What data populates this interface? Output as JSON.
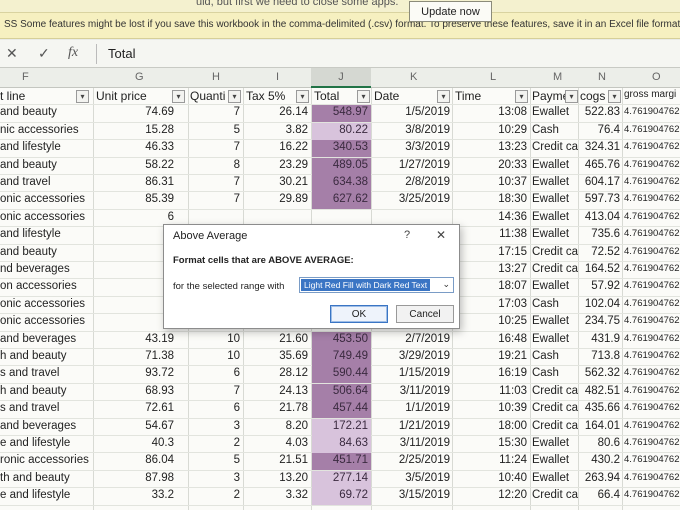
{
  "notification": {
    "update_text": "uld, but first we need to close some apps.",
    "update_button": "Update now",
    "csv_warning": "SS  Some features might be lost if you save this workbook in the comma-delimited (.csv) format. To preserve these features, save it in an Excel file format."
  },
  "formula_bar": {
    "cancel_icon": "✕",
    "enter_icon": "✓",
    "function_icon": "fx",
    "value": "Total"
  },
  "columns": [
    "F",
    "G",
    "H",
    "I",
    "J",
    "K",
    "L",
    "M",
    "N",
    "O"
  ],
  "headers": {
    "product_line": "t line",
    "unit_price": "Unit price",
    "quantity": "Quanti",
    "tax": "Tax 5%",
    "total": "Total",
    "date": "Date",
    "time": "Time",
    "payment": "Payme",
    "cogs": "cogs",
    "gross_margin": "gross margi"
  },
  "colors": {
    "total_dark": "#a57fa8",
    "total_light": "#d8c3dc",
    "dialog_accent": "#3a75c4",
    "notification_bar": "#f6f0c0"
  },
  "rows": [
    {
      "product": "and beauty",
      "price": "74.69",
      "qty": "7",
      "tax": "26.14",
      "total": "548.97",
      "date": "1/5/2019",
      "time": "13:08",
      "pay": "Ewallet",
      "cogs": "522.83",
      "gm": "4.761904762",
      "hl": "dark"
    },
    {
      "product": "nic accessories",
      "price": "15.28",
      "qty": "5",
      "tax": "3.82",
      "total": "80.22",
      "date": "3/8/2019",
      "time": "10:29",
      "pay": "Cash",
      "cogs": "76.4",
      "gm": "4.761904762",
      "hl": "light"
    },
    {
      "product": "and lifestyle",
      "price": "46.33",
      "qty": "7",
      "tax": "16.22",
      "total": "340.53",
      "date": "3/3/2019",
      "time": "13:23",
      "pay": "Credit car",
      "cogs": "324.31",
      "gm": "4.761904762",
      "hl": "dark"
    },
    {
      "product": "and beauty",
      "price": "58.22",
      "qty": "8",
      "tax": "23.29",
      "total": "489.05",
      "date": "1/27/2019",
      "time": "20:33",
      "pay": "Ewallet",
      "cogs": "465.76",
      "gm": "4.761904762",
      "hl": "dark"
    },
    {
      "product": "and travel",
      "price": "86.31",
      "qty": "7",
      "tax": "30.21",
      "total": "634.38",
      "date": "2/8/2019",
      "time": "10:37",
      "pay": "Ewallet",
      "cogs": "604.17",
      "gm": "4.761904762",
      "hl": "dark"
    },
    {
      "product": "onic accessories",
      "price": "85.39",
      "qty": "7",
      "tax": "29.89",
      "total": "627.62",
      "date": "3/25/2019",
      "time": "18:30",
      "pay": "Ewallet",
      "cogs": "597.73",
      "gm": "4.761904762",
      "hl": "dark"
    },
    {
      "product": "onic accessories",
      "price": "6",
      "qty": "",
      "tax": "",
      "total": "",
      "date": "",
      "time": "14:36",
      "pay": "Ewallet",
      "cogs": "413.04",
      "gm": "4.761904762",
      "hl": "dark"
    },
    {
      "product": "and lifestyle",
      "price": "7",
      "qty": "",
      "tax": "",
      "total": "",
      "date": "",
      "time": "11:38",
      "pay": "Ewallet",
      "cogs": "735.6",
      "gm": "4.761904762",
      "hl": "dark"
    },
    {
      "product": "and beauty",
      "price": "3",
      "qty": "",
      "tax": "",
      "total": "",
      "date": "",
      "time": "17:15",
      "pay": "Credit car",
      "cogs": "72.52",
      "gm": "4.761904762",
      "hl": "dark"
    },
    {
      "product": "nd beverages",
      "price": "5",
      "qty": "",
      "tax": "",
      "total": "",
      "date": "",
      "time": "13:27",
      "pay": "Credit car",
      "cogs": "164.52",
      "gm": "4.761904762",
      "hl": "dark"
    },
    {
      "product": "on accessories",
      "price": "1",
      "qty": "",
      "tax": "",
      "total": "",
      "date": "",
      "time": "18:07",
      "pay": "Ewallet",
      "cogs": "57.92",
      "gm": "4.761904762",
      "hl": "dark"
    },
    {
      "product": "onic accessories",
      "price": "2",
      "qty": "",
      "tax": "",
      "total": "",
      "date": "",
      "time": "17:03",
      "pay": "Cash",
      "cogs": "102.04",
      "gm": "4.761904762",
      "hl": "dark"
    },
    {
      "product": "onic accessories",
      "price": "4",
      "qty": "",
      "tax": "",
      "total": "",
      "date": "",
      "time": "10:25",
      "pay": "Ewallet",
      "cogs": "234.75",
      "gm": "4.761904762",
      "hl": "dark"
    },
    {
      "product": "and beverages",
      "price": "43.19",
      "qty": "10",
      "tax": "21.60",
      "total": "453.50",
      "date": "2/7/2019",
      "time": "16:48",
      "pay": "Ewallet",
      "cogs": "431.9",
      "gm": "4.761904762",
      "hl": "dark"
    },
    {
      "product": "h and beauty",
      "price": "71.38",
      "qty": "10",
      "tax": "35.69",
      "total": "749.49",
      "date": "3/29/2019",
      "time": "19:21",
      "pay": "Cash",
      "cogs": "713.8",
      "gm": "4.761904762",
      "hl": "dark"
    },
    {
      "product": "s and travel",
      "price": "93.72",
      "qty": "6",
      "tax": "28.12",
      "total": "590.44",
      "date": "1/15/2019",
      "time": "16:19",
      "pay": "Cash",
      "cogs": "562.32",
      "gm": "4.761904762",
      "hl": "dark"
    },
    {
      "product": "h and beauty",
      "price": "68.93",
      "qty": "7",
      "tax": "24.13",
      "total": "506.64",
      "date": "3/11/2019",
      "time": "11:03",
      "pay": "Credit car",
      "cogs": "482.51",
      "gm": "4.761904762",
      "hl": "dark"
    },
    {
      "product": "s and travel",
      "price": "72.61",
      "qty": "6",
      "tax": "21.78",
      "total": "457.44",
      "date": "1/1/2019",
      "time": "10:39",
      "pay": "Credit car",
      "cogs": "435.66",
      "gm": "4.761904762",
      "hl": "dark"
    },
    {
      "product": "and beverages",
      "price": "54.67",
      "qty": "3",
      "tax": "8.20",
      "total": "172.21",
      "date": "1/21/2019",
      "time": "18:00",
      "pay": "Credit car",
      "cogs": "164.01",
      "gm": "4.761904762",
      "hl": "light"
    },
    {
      "product": "e and lifestyle",
      "price": "40.3",
      "qty": "2",
      "tax": "4.03",
      "total": "84.63",
      "date": "3/11/2019",
      "time": "15:30",
      "pay": "Ewallet",
      "cogs": "80.6",
      "gm": "4.761904762",
      "hl": "light"
    },
    {
      "product": "ronic accessories",
      "price": "86.04",
      "qty": "5",
      "tax": "21.51",
      "total": "451.71",
      "date": "2/25/2019",
      "time": "11:24",
      "pay": "Ewallet",
      "cogs": "430.2",
      "gm": "4.761904762",
      "hl": "dark"
    },
    {
      "product": "th and beauty",
      "price": "87.98",
      "qty": "3",
      "tax": "13.20",
      "total": "277.14",
      "date": "3/5/2019",
      "time": "10:40",
      "pay": "Ewallet",
      "cogs": "263.94",
      "gm": "4.761904762",
      "hl": "light"
    },
    {
      "product": "e and lifestyle",
      "price": "33.2",
      "qty": "2",
      "tax": "3.32",
      "total": "69.72",
      "date": "3/15/2019",
      "time": "12:20",
      "pay": "Credit car",
      "cogs": "66.4",
      "gm": "4.761904762",
      "hl": "light"
    }
  ],
  "dialog": {
    "title": "Above Average",
    "help": "?",
    "close": "✕",
    "heading": "Format cells that are ABOVE AVERAGE:",
    "label": "for the selected range with",
    "format_value": "Light Red Fill with Dark Red Text",
    "chevron": "⌄",
    "ok": "OK",
    "cancel": "Cancel"
  }
}
